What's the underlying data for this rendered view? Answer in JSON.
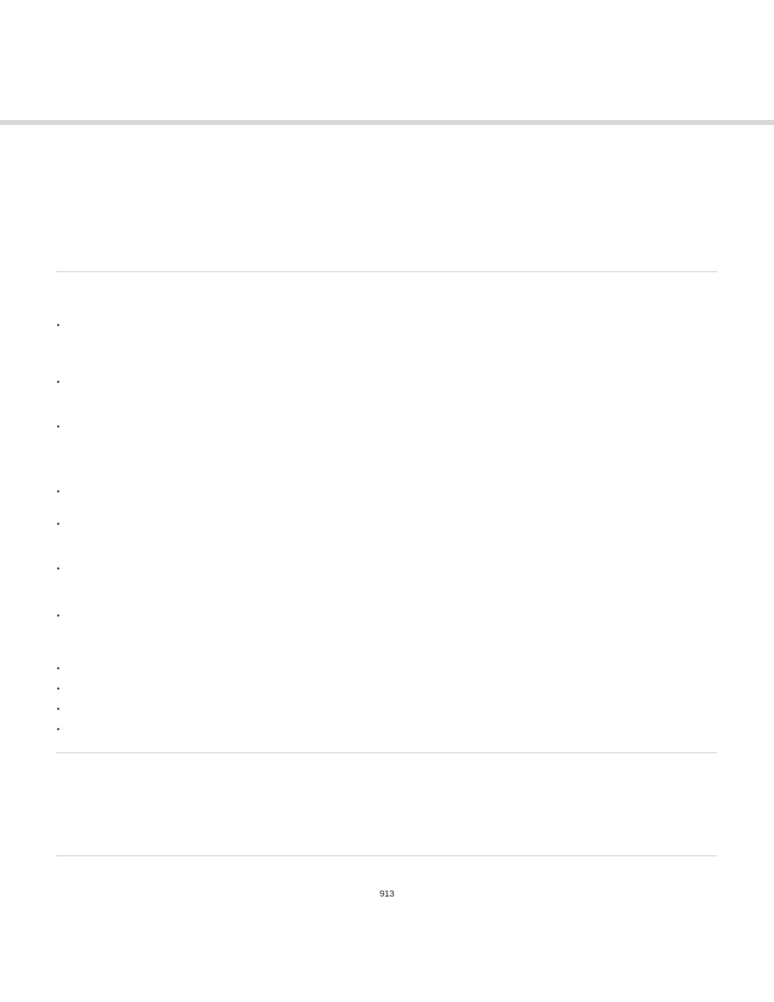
{
  "page_number": "913"
}
